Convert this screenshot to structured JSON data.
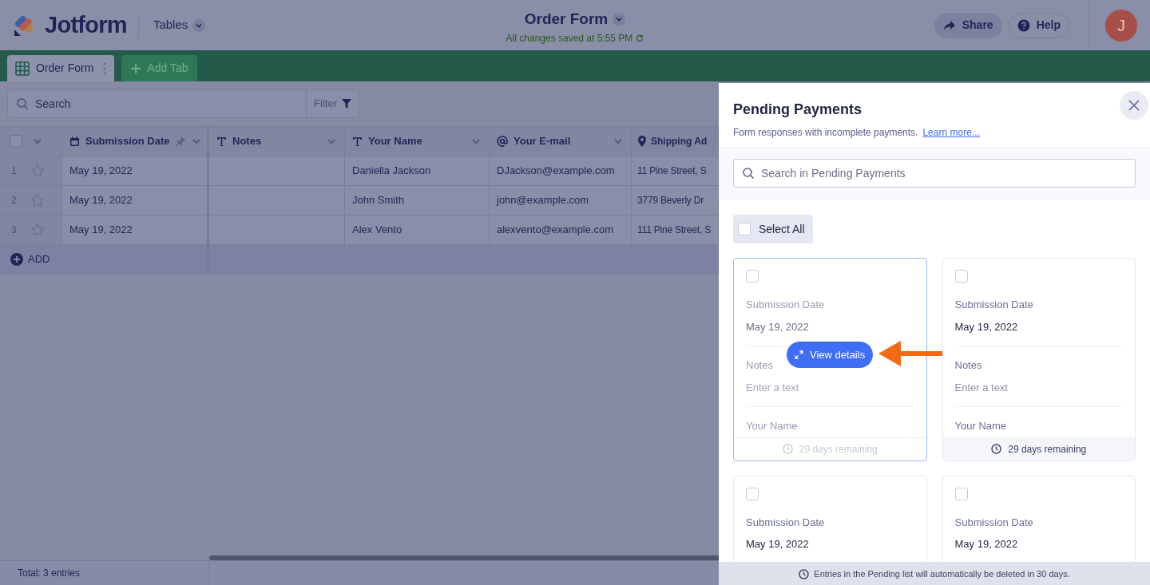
{
  "header": {
    "logo": "Jotform",
    "menu": "Tables",
    "title": "Order Form",
    "save_status": "All changes saved at 5:55 PM",
    "buttons": [
      {
        "label": "Share",
        "kind": "share"
      },
      {
        "label": "Help",
        "kind": "help"
      }
    ],
    "avatar": "J"
  },
  "tabs": [
    {
      "label": "Order Form",
      "selected": true
    }
  ],
  "add_tab": "Add Tab",
  "toolbar": {
    "search_placeholder": "Search",
    "filter": "Filter"
  },
  "table": {
    "select_all_checked": false,
    "columns": [
      {
        "label": "Submission Date",
        "kind": "date",
        "pinned": true
      },
      {
        "label": "Notes",
        "kind": "text",
        "pinned": false
      },
      {
        "label": "Your Name",
        "kind": "text",
        "pinned": false
      },
      {
        "label": "Your E-mail",
        "kind": "email",
        "pinned": false
      },
      {
        "label": "Shipping Ad",
        "kind": "address",
        "pinned": false
      }
    ],
    "rows": [
      {
        "number": "1",
        "starred": false,
        "cells": [
          "May 19, 2022",
          null,
          "Daniella Jackson",
          "DJackson@example.com",
          "11 Pine Street, S"
        ]
      },
      {
        "number": "2",
        "starred": false,
        "cells": [
          "May 19, 2022",
          null,
          "John Smith",
          "john@example.com",
          "3779 Beverly Dr"
        ]
      },
      {
        "number": "3",
        "starred": false,
        "cells": [
          "May 19, 2022",
          null,
          "Alex Vento",
          "alexvento@example.com",
          "111 Pine Street, S"
        ]
      }
    ],
    "add_row": "ADD"
  },
  "status_bar": "Total: 3 entries",
  "panel": {
    "title": "Pending Payments",
    "subtitle": "Form responses with incomplete payments.",
    "link": "Learn more...",
    "search_placeholder": "Search in Pending Payments",
    "select_all": {
      "label": "Select All",
      "checked": false
    },
    "cards": [
      {
        "checked": false,
        "highlighted": true,
        "action": "View details",
        "fields": [
          {
            "label": "Submission Date",
            "value": "May 19, 2022"
          },
          {
            "label": "Notes",
            "placeholder": "Enter a text"
          },
          {
            "label": "Your Name"
          }
        ],
        "footer": "29 days remaining"
      },
      {
        "checked": false,
        "highlighted": false,
        "fields": [
          {
            "label": "Submission Date",
            "value": "May 19, 2022"
          },
          {
            "label": "Notes",
            "placeholder": "Enter a text"
          },
          {
            "label": "Your Name"
          }
        ],
        "footer": "29 days remaining"
      },
      {
        "checked": false,
        "highlighted": false,
        "fields": [
          {
            "label": "Submission Date",
            "value": "May 19, 2022"
          }
        ]
      },
      {
        "checked": false,
        "highlighted": false,
        "fields": [
          {
            "label": "Submission Date",
            "value": "May 19, 2022"
          }
        ]
      }
    ],
    "footer_note": "Entries in the Pending list will automatically be deleted in 30 days."
  }
}
